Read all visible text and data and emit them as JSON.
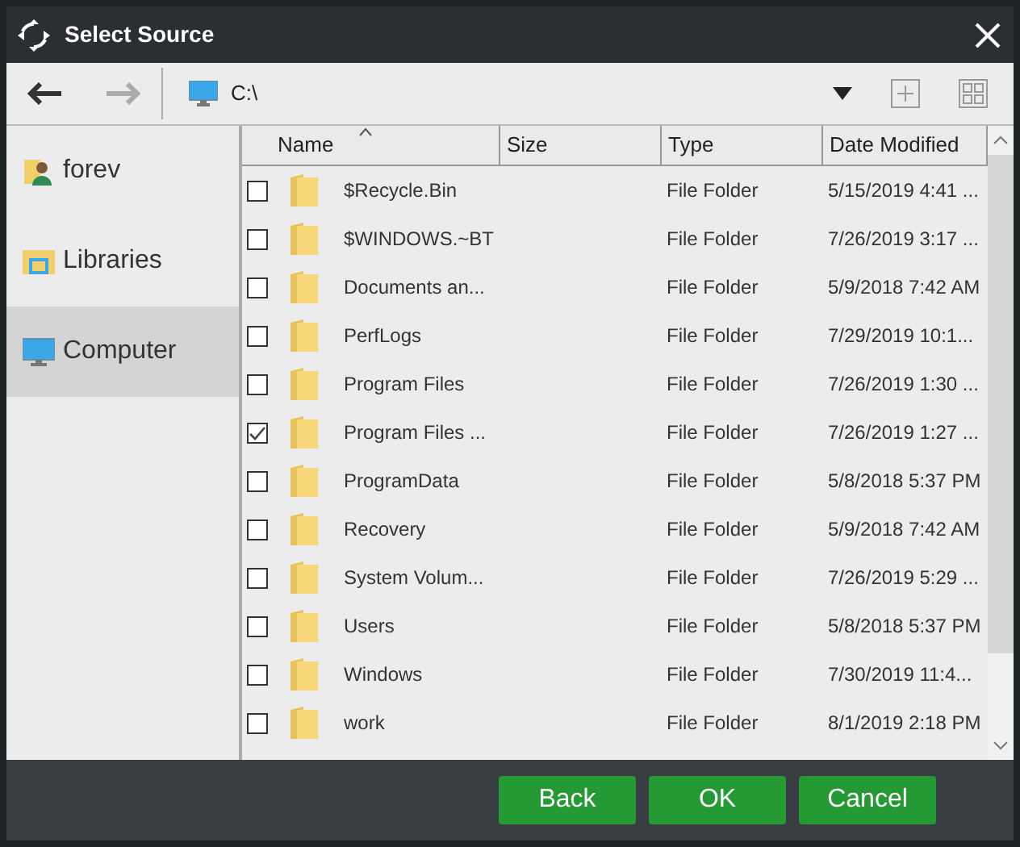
{
  "window": {
    "title": "Select Source"
  },
  "toolbar": {
    "path": "C:\\"
  },
  "sidebar": {
    "items": [
      {
        "label": "forev",
        "kind": "user",
        "selected": false
      },
      {
        "label": "Libraries",
        "kind": "libraries",
        "selected": false
      },
      {
        "label": "Computer",
        "kind": "computer",
        "selected": true
      }
    ]
  },
  "table": {
    "columns": [
      {
        "label": "Name",
        "sorted": true
      },
      {
        "label": "Size",
        "sorted": false
      },
      {
        "label": "Type",
        "sorted": false
      },
      {
        "label": "Date Modified",
        "sorted": false
      }
    ],
    "rows": [
      {
        "checked": false,
        "name": "$Recycle.Bin",
        "type": "File Folder",
        "date": "5/15/2019 4:41 ..."
      },
      {
        "checked": false,
        "name": "$WINDOWS.~BT",
        "type": "File Folder",
        "date": "7/26/2019 3:17 ..."
      },
      {
        "checked": false,
        "name": "Documents an...",
        "type": "File Folder",
        "date": "5/9/2018 7:42 AM"
      },
      {
        "checked": false,
        "name": "PerfLogs",
        "type": "File Folder",
        "date": "7/29/2019 10:1..."
      },
      {
        "checked": false,
        "name": "Program Files",
        "type": "File Folder",
        "date": "7/26/2019 1:30 ..."
      },
      {
        "checked": true,
        "name": "Program Files ...",
        "type": "File Folder",
        "date": "7/26/2019 1:27 ..."
      },
      {
        "checked": false,
        "name": "ProgramData",
        "type": "File Folder",
        "date": "5/8/2018 5:37 PM"
      },
      {
        "checked": false,
        "name": "Recovery",
        "type": "File Folder",
        "date": "5/9/2018 7:42 AM"
      },
      {
        "checked": false,
        "name": "System Volum...",
        "type": "File Folder",
        "date": "7/26/2019 5:29 ..."
      },
      {
        "checked": false,
        "name": "Users",
        "type": "File Folder",
        "date": "5/8/2018 5:37 PM"
      },
      {
        "checked": false,
        "name": "Windows",
        "type": "File Folder",
        "date": "7/30/2019 11:4..."
      },
      {
        "checked": false,
        "name": "work",
        "type": "File Folder",
        "date": "8/1/2019 2:18 PM"
      }
    ]
  },
  "buttons": [
    "Back",
    "OK",
    "Cancel"
  ]
}
